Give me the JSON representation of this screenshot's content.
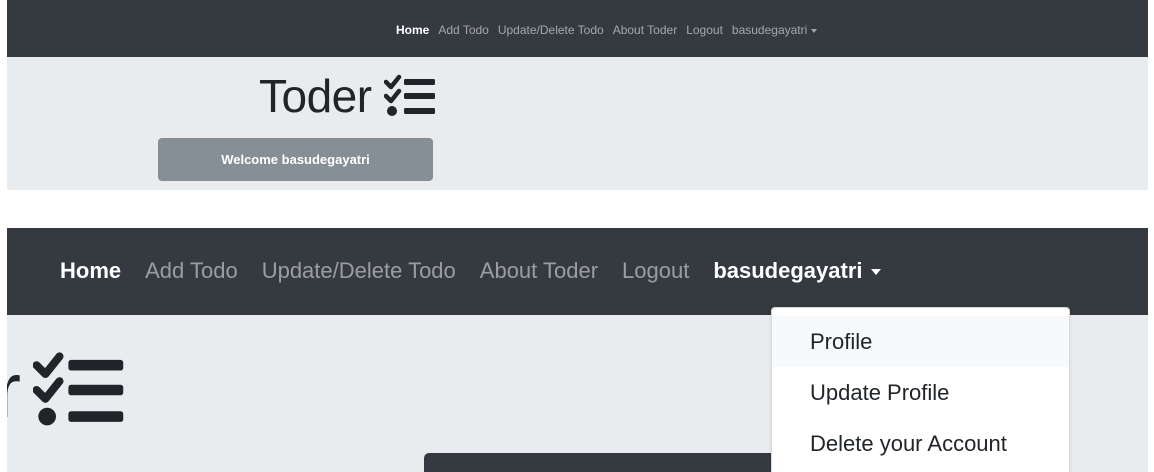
{
  "nav": {
    "home": "Home",
    "add_todo": "Add Todo",
    "update_delete": "Update/Delete Todo",
    "about": "About Toder",
    "logout": "Logout",
    "user": "basudegayatri"
  },
  "brand": {
    "title": "Toder",
    "title_cropped": "r",
    "icon": "checklist-icon"
  },
  "welcome": "Welcome basudegayatri",
  "dropdown": {
    "items": [
      "Profile",
      "Update Profile",
      "Delete your Account"
    ]
  },
  "colors": {
    "navbar": "#343a40",
    "jumbotron": "#e9ecef",
    "welcome_button": "#868e96"
  }
}
